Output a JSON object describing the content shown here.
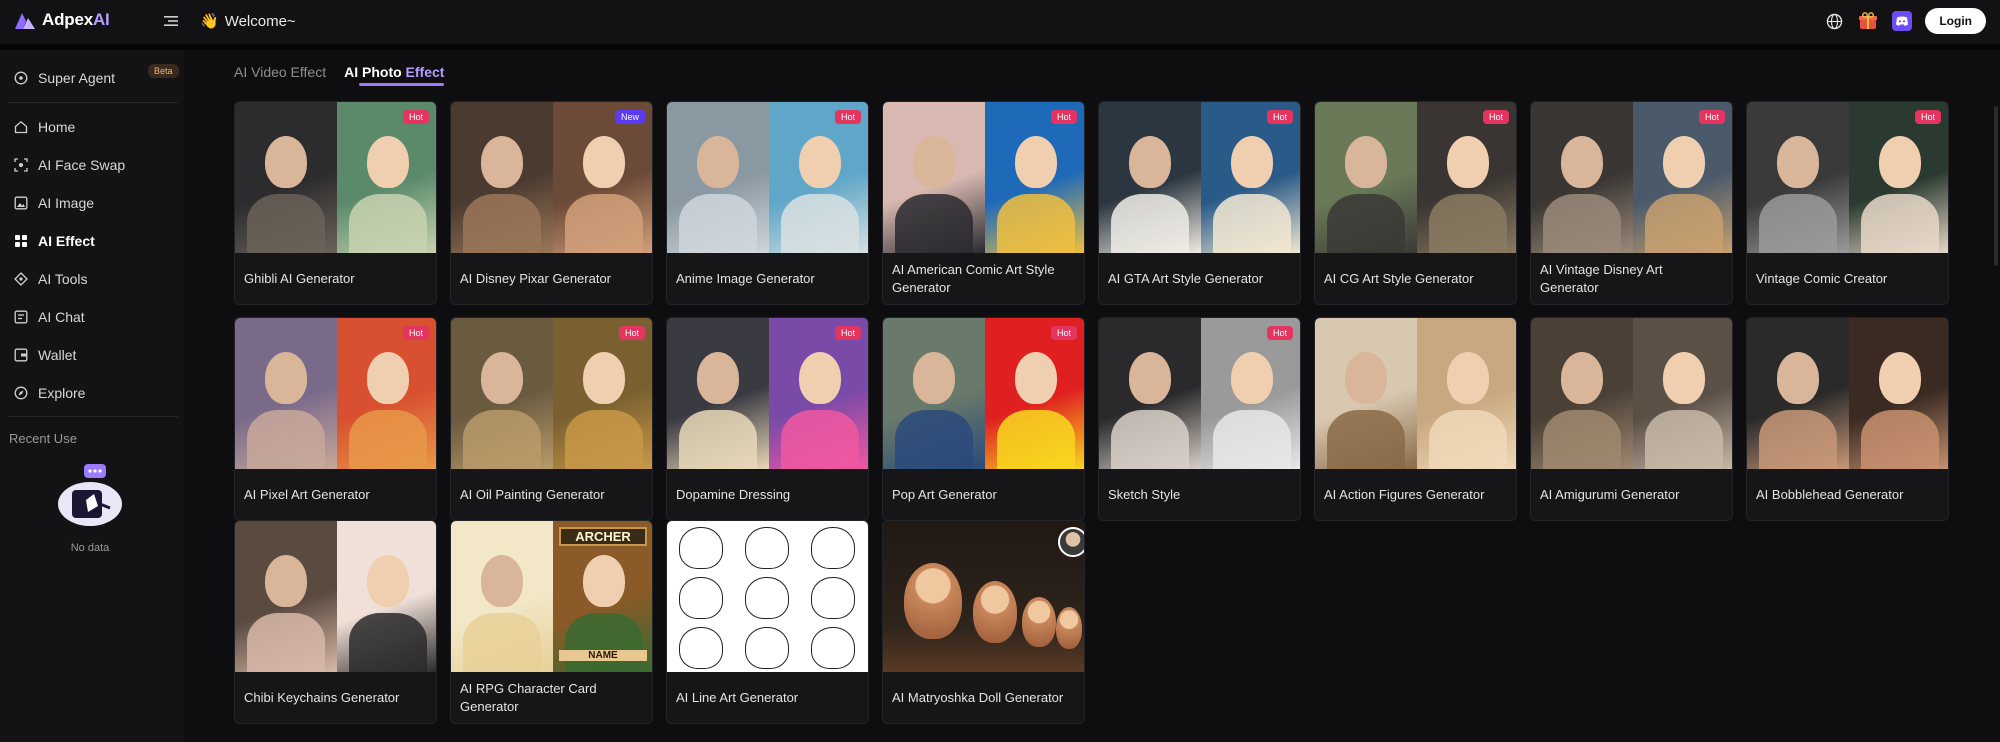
{
  "header": {
    "logo_text_a": "Adpex",
    "logo_text_b": "AI",
    "welcome": "Welcome~",
    "login_label": "Login"
  },
  "sidebar": {
    "items": [
      {
        "label": "Super Agent",
        "icon": "agent-icon"
      },
      {
        "label": "Home",
        "icon": "home-icon"
      },
      {
        "label": "AI Face Swap",
        "icon": "face-swap-icon"
      },
      {
        "label": "AI Image",
        "icon": "image-icon"
      },
      {
        "label": "AI Effect",
        "icon": "effect-icon"
      },
      {
        "label": "AI Tools",
        "icon": "tools-icon"
      },
      {
        "label": "AI Chat",
        "icon": "chat-icon"
      },
      {
        "label": "Wallet",
        "icon": "wallet-icon"
      },
      {
        "label": "Explore",
        "icon": "explore-icon"
      }
    ],
    "beta_label": "Beta",
    "recent_label": "Recent Use",
    "no_data": "No data"
  },
  "tabs": [
    {
      "label": "AI Video Effect"
    },
    {
      "label_a": "AI Photo",
      "label_b": " Effect"
    }
  ],
  "cards": [
    {
      "title": "Ghibli AI Generator",
      "badge": "Hot"
    },
    {
      "title": "AI Disney Pixar Generator",
      "badge": "New"
    },
    {
      "title": "Anime Image Generator",
      "badge": "Hot"
    },
    {
      "title": "AI American Comic Art Style Generator",
      "badge": "Hot"
    },
    {
      "title": "AI GTA Art Style Generator",
      "badge": "Hot"
    },
    {
      "title": "AI CG Art Style Generator",
      "badge": "Hot"
    },
    {
      "title": "AI Vintage Disney Art Generator",
      "badge": "Hot"
    },
    {
      "title": "Vintage Comic Creator",
      "badge": "Hot"
    },
    {
      "title": "AI Pixel Art Generator",
      "badge": "Hot"
    },
    {
      "title": "AI Oil Painting Generator",
      "badge": "Hot"
    },
    {
      "title": "Dopamine Dressing",
      "badge": "Hot"
    },
    {
      "title": "Pop Art Generator",
      "badge": "Hot"
    },
    {
      "title": "Sketch Style",
      "badge": "Hot"
    },
    {
      "title": "AI Action Figures Generator",
      "badge": ""
    },
    {
      "title": "AI Amigurumi Generator",
      "badge": ""
    },
    {
      "title": "AI Bobblehead Generator",
      "badge": ""
    },
    {
      "title": "Chibi Keychains Generator",
      "badge": ""
    },
    {
      "title": "AI RPG Character Card Generator",
      "badge": ""
    },
    {
      "title": "AI Line Art Generator",
      "badge": ""
    },
    {
      "title": "AI Matryoshka Doll Generator",
      "badge": ""
    }
  ],
  "rpg_card_text_top": "ARCHER",
  "rpg_card_text_bottom": "NAME",
  "colors": {
    "accent": "#9c7bff",
    "hot_badge": "#e2355f",
    "new_badge": "#5b3bf2"
  }
}
